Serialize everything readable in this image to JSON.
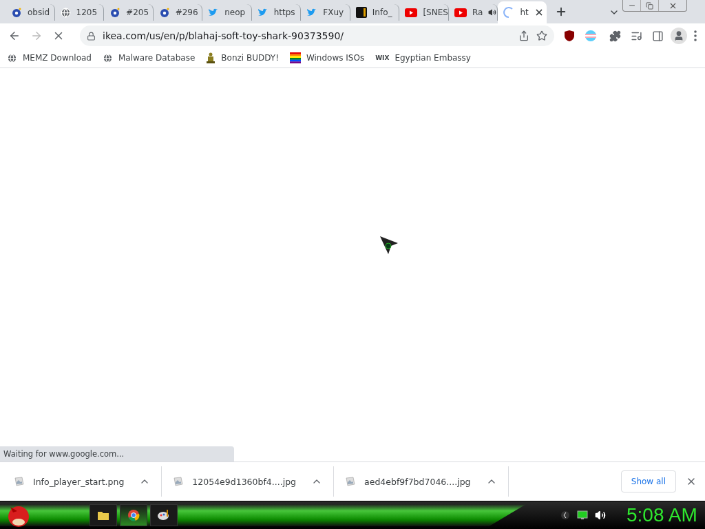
{
  "tabs": [
    {
      "title": "obsid",
      "kind": "edge",
      "selected": false
    },
    {
      "title": "1205",
      "kind": "globe",
      "selected": false
    },
    {
      "title": "#205",
      "kind": "edge",
      "selected": false
    },
    {
      "title": "#296",
      "kind": "edge",
      "selected": false
    },
    {
      "title": "neop",
      "kind": "bird",
      "selected": false
    },
    {
      "title": "https",
      "kind": "bird",
      "selected": false
    },
    {
      "title": "FXuy",
      "kind": "bird",
      "selected": false
    },
    {
      "title": "Info_",
      "kind": "s",
      "selected": false
    },
    {
      "title": "[SNES",
      "kind": "play",
      "selected": false
    },
    {
      "title": "Ra",
      "kind": "play",
      "selected": false,
      "audio": true
    },
    {
      "title": "ht",
      "kind": "loading",
      "selected": true
    }
  ],
  "address": {
    "url": "ikea.com/us/en/p/blahaj-soft-toy-shark-90373590/",
    "loading": true
  },
  "bookmarks": [
    {
      "label": "MEMZ Download",
      "kind": "globe"
    },
    {
      "label": "Malware Database",
      "kind": "globe"
    },
    {
      "label": "Bonzi BUDDY!",
      "kind": "figure"
    },
    {
      "label": "Windows ISOs",
      "kind": "rainbow"
    },
    {
      "label": "Egyptian Embassy",
      "kind": "wix",
      "icon_text": "WIX"
    }
  ],
  "status": "Waiting for www.google.com...",
  "downloads": [
    {
      "name": "Info_player_start.png"
    },
    {
      "name": "12054e9d1360bf4....jpg"
    },
    {
      "name": "aed4ebf9f7bd7046....jpg"
    }
  ],
  "show_all": "Show all",
  "taskbar": {
    "apps": [
      {
        "kind": "folder",
        "selected": false
      },
      {
        "kind": "browser",
        "selected": true
      },
      {
        "kind": "paint",
        "selected": false
      }
    ],
    "clock": "5:08 AM"
  }
}
